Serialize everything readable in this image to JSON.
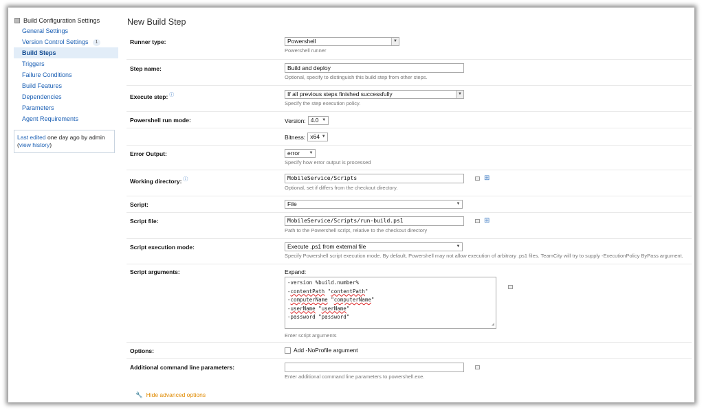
{
  "sidebar": {
    "header": "Build Configuration Settings",
    "items": [
      {
        "label": "General Settings"
      },
      {
        "label": "Version Control Settings",
        "badge": "1"
      },
      {
        "label": "Build Steps",
        "active": true
      },
      {
        "label": "Triggers"
      },
      {
        "label": "Failure Conditions"
      },
      {
        "label": "Build Features"
      },
      {
        "label": "Dependencies"
      },
      {
        "label": "Parameters"
      },
      {
        "label": "Agent Requirements"
      }
    ],
    "last_edited": {
      "link": "Last edited",
      "text": " one day ago  by admin",
      "paren_open": "(",
      "history_link": "view history",
      "paren_close": ")"
    }
  },
  "main": {
    "title": "New Build Step",
    "runner_type": {
      "label": "Runner type:",
      "value": "Powershell",
      "hint": "Powershell runner"
    },
    "step_name": {
      "label": "Step name:",
      "value": "Build and deploy",
      "hint": "Optional, specify to distinguish this build step from other steps."
    },
    "execute_step": {
      "label": "Execute step:",
      "value": "If all previous steps finished successfully",
      "hint": "Specify the step execution policy."
    },
    "run_mode": {
      "label": "Powershell run mode:",
      "version_label": "Version:",
      "version_value": "4.0",
      "bitness_label": "Bitness:",
      "bitness_value": "x64"
    },
    "error_output": {
      "label": "Error Output:",
      "value": "error",
      "hint": "Specify how error output is processed"
    },
    "working_dir": {
      "label": "Working directory:",
      "value": "MobileService/Scripts",
      "hint": "Optional, set if differs from the checkout directory."
    },
    "script": {
      "label": "Script:",
      "value": "File"
    },
    "script_file": {
      "label": "Script file:",
      "value": "MobileService/Scripts/run-build.ps1",
      "hint": "Path to the Powershell script, relative to the checkout directory"
    },
    "exec_mode": {
      "label": "Script execution mode:",
      "value": "Execute .ps1 from external file",
      "hint": "Specify Powershell script execution mode. By default, Powershell may not allow execution of arbitrary .ps1 files. TeamCity will try to supply -ExecutionPolicy ByPass argument."
    },
    "script_args": {
      "label": "Script arguments:",
      "expand": "Expand:",
      "lines": [
        {
          "pre": "-version %build.number%",
          "flag": "",
          "sp": "",
          "val": "",
          "q": ""
        },
        {
          "pre": "-",
          "flag": "contentPath",
          "sp": " \"",
          "val": "contentPath",
          "q": "\""
        },
        {
          "pre": "-",
          "flag": "computerName",
          "sp": " \"",
          "val": "computerName",
          "q": "\""
        },
        {
          "pre": "-",
          "flag": "userName",
          "sp": " \"",
          "val": "userName",
          "q": "\""
        },
        {
          "pre": "-password \"password\"",
          "flag": "",
          "sp": "",
          "val": "",
          "q": ""
        }
      ],
      "hint": "Enter script arguments"
    },
    "options": {
      "label": "Options:",
      "checkbox_label": "Add -NoProfile argument"
    },
    "additional": {
      "label": "Additional command line parameters:",
      "value": "",
      "hint": "Enter additional command line parameters to powershell.exe."
    },
    "advanced_link": "Hide advanced options"
  },
  "icons": {
    "help": "help-icon",
    "dropdown": "chevron-down-icon",
    "tree": "directory-tree-icon",
    "wrench": "wrench-icon"
  },
  "colors": {
    "link": "#1a5fb4",
    "active_bg": "#e2edf8",
    "advanced": "#e08a00"
  }
}
